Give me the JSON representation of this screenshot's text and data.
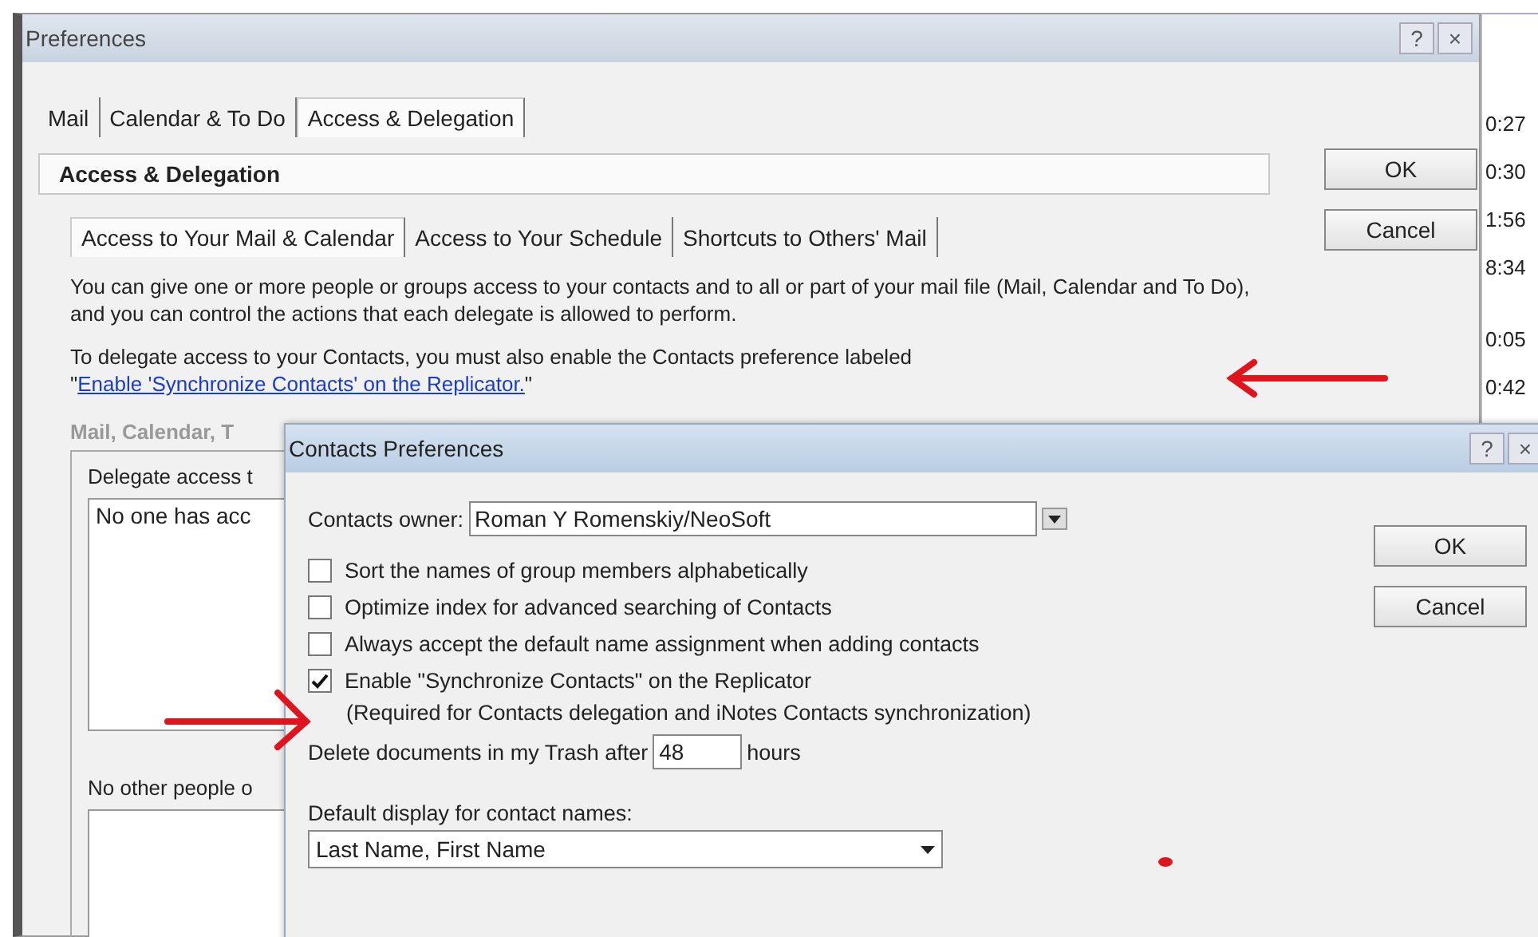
{
  "window": {
    "title": "Preferences",
    "help": "?",
    "close": "×"
  },
  "tabs": [
    {
      "label": "Mail",
      "selected": false
    },
    {
      "label": "Calendar & To Do",
      "selected": false
    },
    {
      "label": "Access & Delegation",
      "selected": true
    }
  ],
  "section_title": "Access & Delegation",
  "subtabs": [
    {
      "label": "Access to Your Mail & Calendar",
      "selected": true
    },
    {
      "label": "Access to Your Schedule",
      "selected": false
    },
    {
      "label": "Shortcuts to Others' Mail",
      "selected": false
    }
  ],
  "intro": "You can give one or more people or groups access to your contacts and to all or part of your mail file (Mail, Calendar and To Do), and you can control the actions that each delegate is allowed to perform.",
  "note": {
    "before": "To delegate access to your Contacts, you must also enable the Contacts preference labeled \"",
    "link": "Enable 'Synchronize Contacts' on the Replicator.",
    "after": "\""
  },
  "group_label": "Mail, Calendar, T",
  "delegate_label": "Delegate access t",
  "delegate_list": [
    "No one has acc"
  ],
  "other_label": "No other people o",
  "buttons": [
    "OK",
    "Cancel"
  ],
  "background_list": {
    "column_1": [
      "0:27",
      "0:30",
      "1:56",
      "8:34",
      "0:05",
      "0:42"
    ]
  },
  "dialog": {
    "title": "Contacts Preferences",
    "help": "?",
    "close": "×",
    "owner_label": "Contacts owner:",
    "owner_value": "Roman Y Romenskiy/NeoSoft",
    "options": [
      {
        "label": "Sort the names of group members alphabetically",
        "checked": false
      },
      {
        "label": "Optimize index for advanced searching of Contacts",
        "checked": false
      },
      {
        "label": "Always accept the default name assignment when adding contacts",
        "checked": false
      },
      {
        "label": "Enable \"Synchronize Contacts\" on the Replicator",
        "checked": true,
        "note": "(Required for Contacts delegation and iNotes Contacts synchronization)"
      }
    ],
    "trash_before": "Delete documents in my Trash after",
    "trash_value": "48",
    "trash_after": "hours",
    "display_label": "Default display for contact names:",
    "display_value": "Last Name, First Name",
    "buttons": [
      "OK",
      "Cancel"
    ]
  }
}
